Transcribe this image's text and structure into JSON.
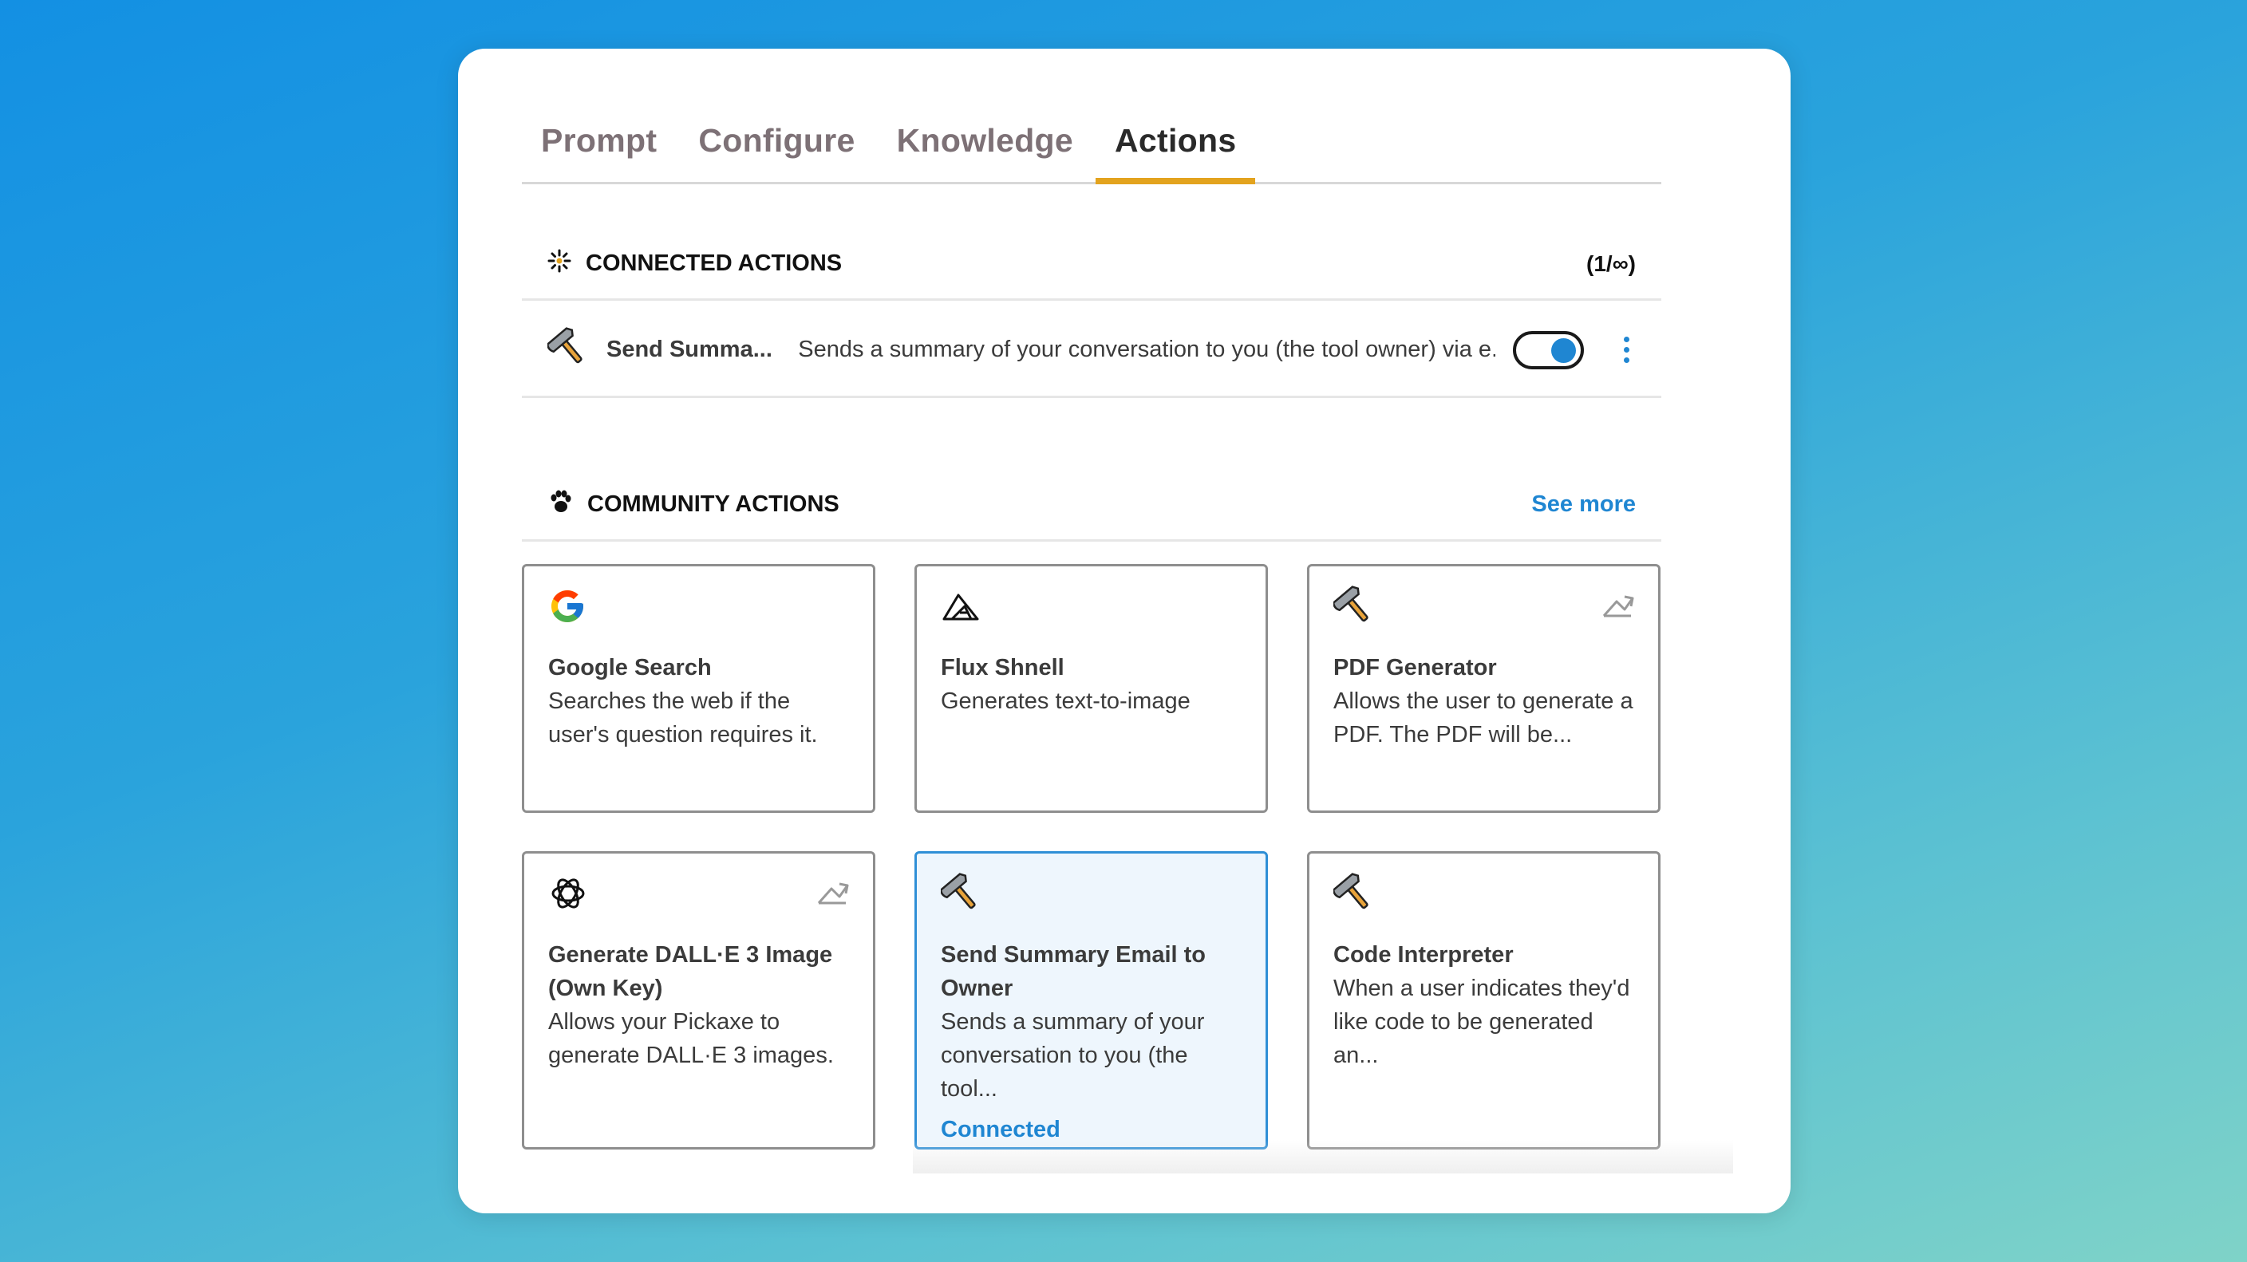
{
  "tabs": [
    {
      "label": "Prompt",
      "active": false
    },
    {
      "label": "Configure",
      "active": false
    },
    {
      "label": "Knowledge",
      "active": false
    },
    {
      "label": "Actions",
      "active": true
    }
  ],
  "connected_actions": {
    "title": "CONNECTED ACTIONS",
    "count": "(1/∞)",
    "items": [
      {
        "icon": "hammer-icon",
        "name": "Send Summa...",
        "description": "Sends a summary of your conversation to you (the tool owner) via e...",
        "enabled": true
      }
    ]
  },
  "community_actions": {
    "title": "COMMUNITY ACTIONS",
    "see_more": "See more",
    "cards": [
      {
        "icon": "google-icon",
        "title": "Google Search",
        "description": "Searches the web if the user's question requires it.",
        "external": false,
        "status": ""
      },
      {
        "icon": "flux-icon",
        "title": "Flux Shnell",
        "description": "Generates text-to-image",
        "external": false,
        "status": ""
      },
      {
        "icon": "hammer-icon",
        "title": "PDF Generator",
        "description": "Allows the user to generate a PDF. The PDF will be...",
        "external": true,
        "status": ""
      },
      {
        "icon": "openai-icon",
        "title": "Generate DALL·E 3 Image (Own Key)",
        "description": "Allows your Pickaxe to generate DALL·E 3 images.",
        "external": true,
        "status": ""
      },
      {
        "icon": "hammer-icon",
        "title": "Send Summary Email to Owner",
        "description": "Sends a summary of your conversation to you (the tool...",
        "external": false,
        "status": "Connected"
      },
      {
        "icon": "hammer-icon",
        "title": "Code Interpreter",
        "description": "When a user indicates they'd like code to be generated an...",
        "external": false,
        "status": ""
      }
    ]
  },
  "colors": {
    "accent": "#1f86d2",
    "tab_underline": "#e3a31e",
    "connected_bg": "#eef6fd"
  }
}
